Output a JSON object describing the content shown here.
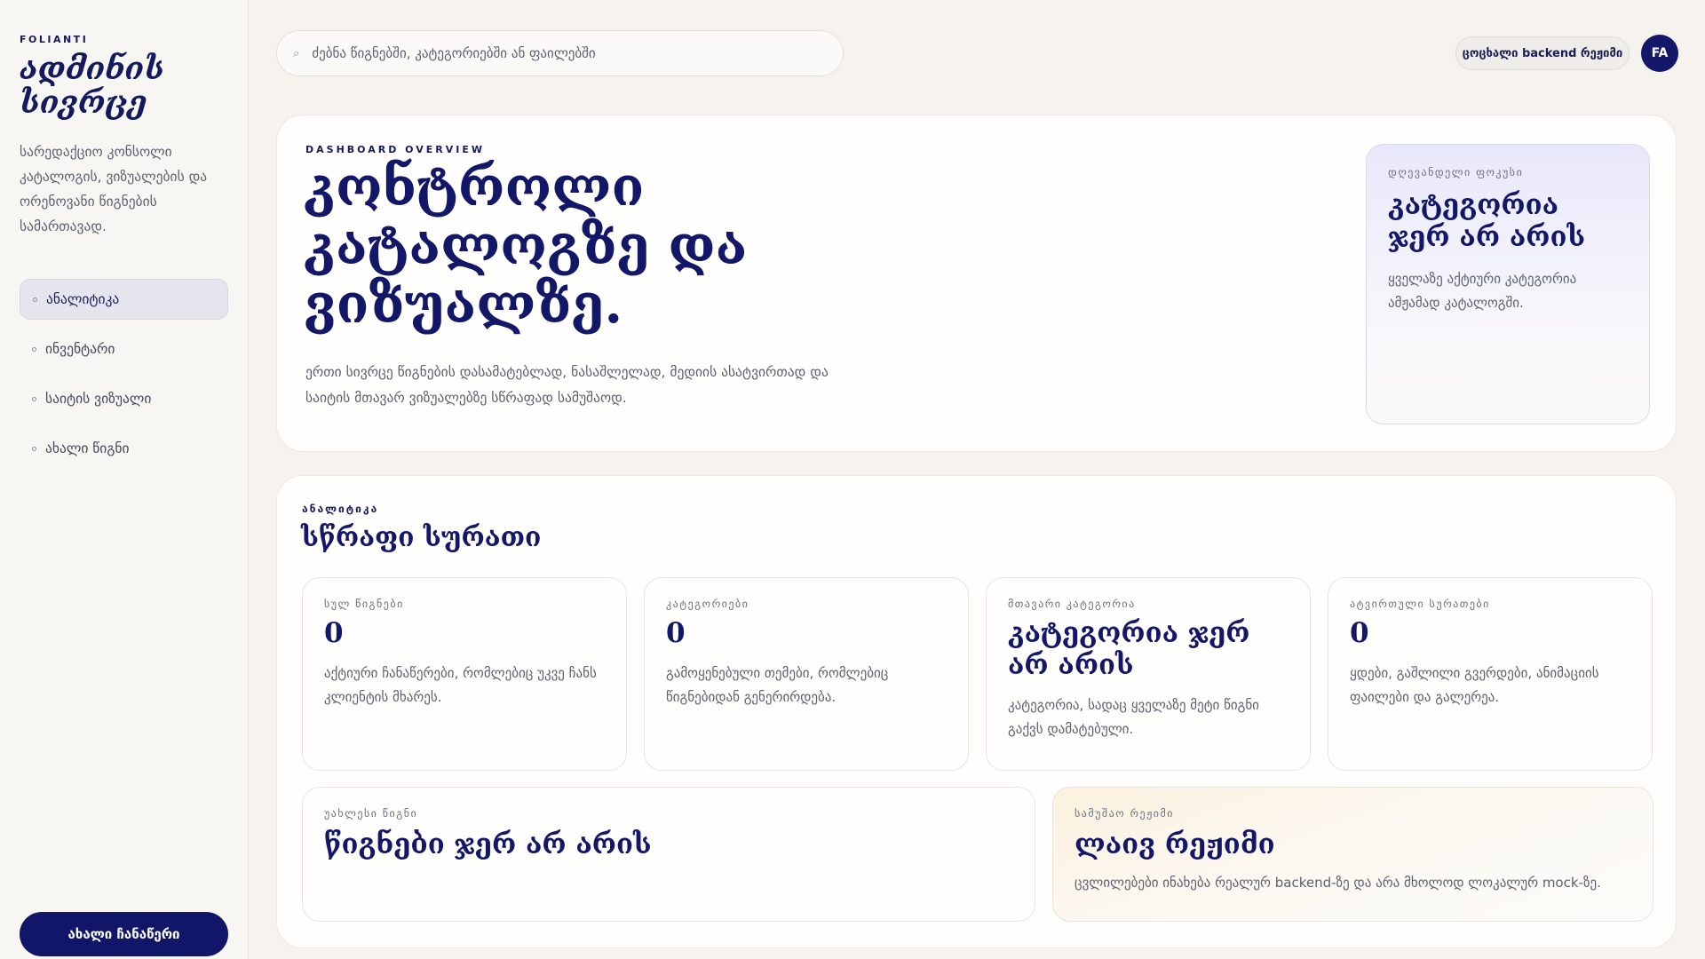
{
  "sidebar": {
    "brand_kicker": "FOLIANTI",
    "brand_title": "ადმინის სივრცე",
    "brand_desc": "სარედაქციო კონსოლი კატალოგის, ვიზუალების და ორენოვანი წიგნების სამართავად.",
    "nav": [
      {
        "label": "ანალიტიკა",
        "active": true
      },
      {
        "label": "ინვენტარი",
        "active": false
      },
      {
        "label": "საიტის ვიზუალი",
        "active": false
      },
      {
        "label": "ახალი წიგნი",
        "active": false
      }
    ],
    "cta_label": "ახალი ჩანაწერი"
  },
  "topbar": {
    "search_placeholder": "ძებნა წიგნებში, კატეგორიებში ან ფაილებში",
    "search_icon": "⌕",
    "mode_label": "ცოცხალი backend რეჟიმი",
    "avatar_initials": "FA"
  },
  "hero": {
    "kicker": "DASHBOARD OVERVIEW",
    "title": "კონტროლი კატალოგზე და ვიზუალზე.",
    "desc": "ერთი სივრცე წიგნების დასამატებლად, ნასაშლელად, მედიის ასატვირთად და საიტის მთავარ ვიზუალებზე სწრაფად სამუშაოდ.",
    "focus": {
      "label": "დღევანდელი ფოკუსი",
      "title": "კატეგორია ჯერ არ არის",
      "desc": "ყველაზე აქტიური კატეგორია ამჟამად კატალოგში."
    }
  },
  "analytics": {
    "kicker": "ანალიტიკა",
    "title": "სწრაფი სურათი",
    "stats": [
      {
        "label": "სულ წიგნები",
        "value": "0",
        "desc": "აქტიური ჩანაწერები, რომლებიც უკვე ჩანს კლიენტის მხარეს."
      },
      {
        "label": "კატეგორიები",
        "value": "0",
        "desc": "გამოყენებული თემები, რომლებიც წიგნებიდან გენერირდება."
      },
      {
        "label": "მთავარი კატეგორია",
        "value": "კატეგორია ჯერ არ არის",
        "desc": "კატეგორია, სადაც ყველაზე მეტი წიგნი გაქვს დამატებული."
      },
      {
        "label": "ატვირთული სურათები",
        "value": "0",
        "desc": "ყდები, გაშლილი გვერდები, ანიმაციის ფაილები და გალერეა."
      }
    ],
    "newest": {
      "label": "უახლესი წიგნი",
      "title": "წიგნები ჯერ არ არის"
    },
    "mode": {
      "label": "სამუშაო რეჟიმი",
      "title": "ლაივ რეჟიმი",
      "desc": "ცვლილებები ინახება რეალურ backend-ზე და არა მხოლოდ ლოკალურ mock-ზე."
    }
  }
}
